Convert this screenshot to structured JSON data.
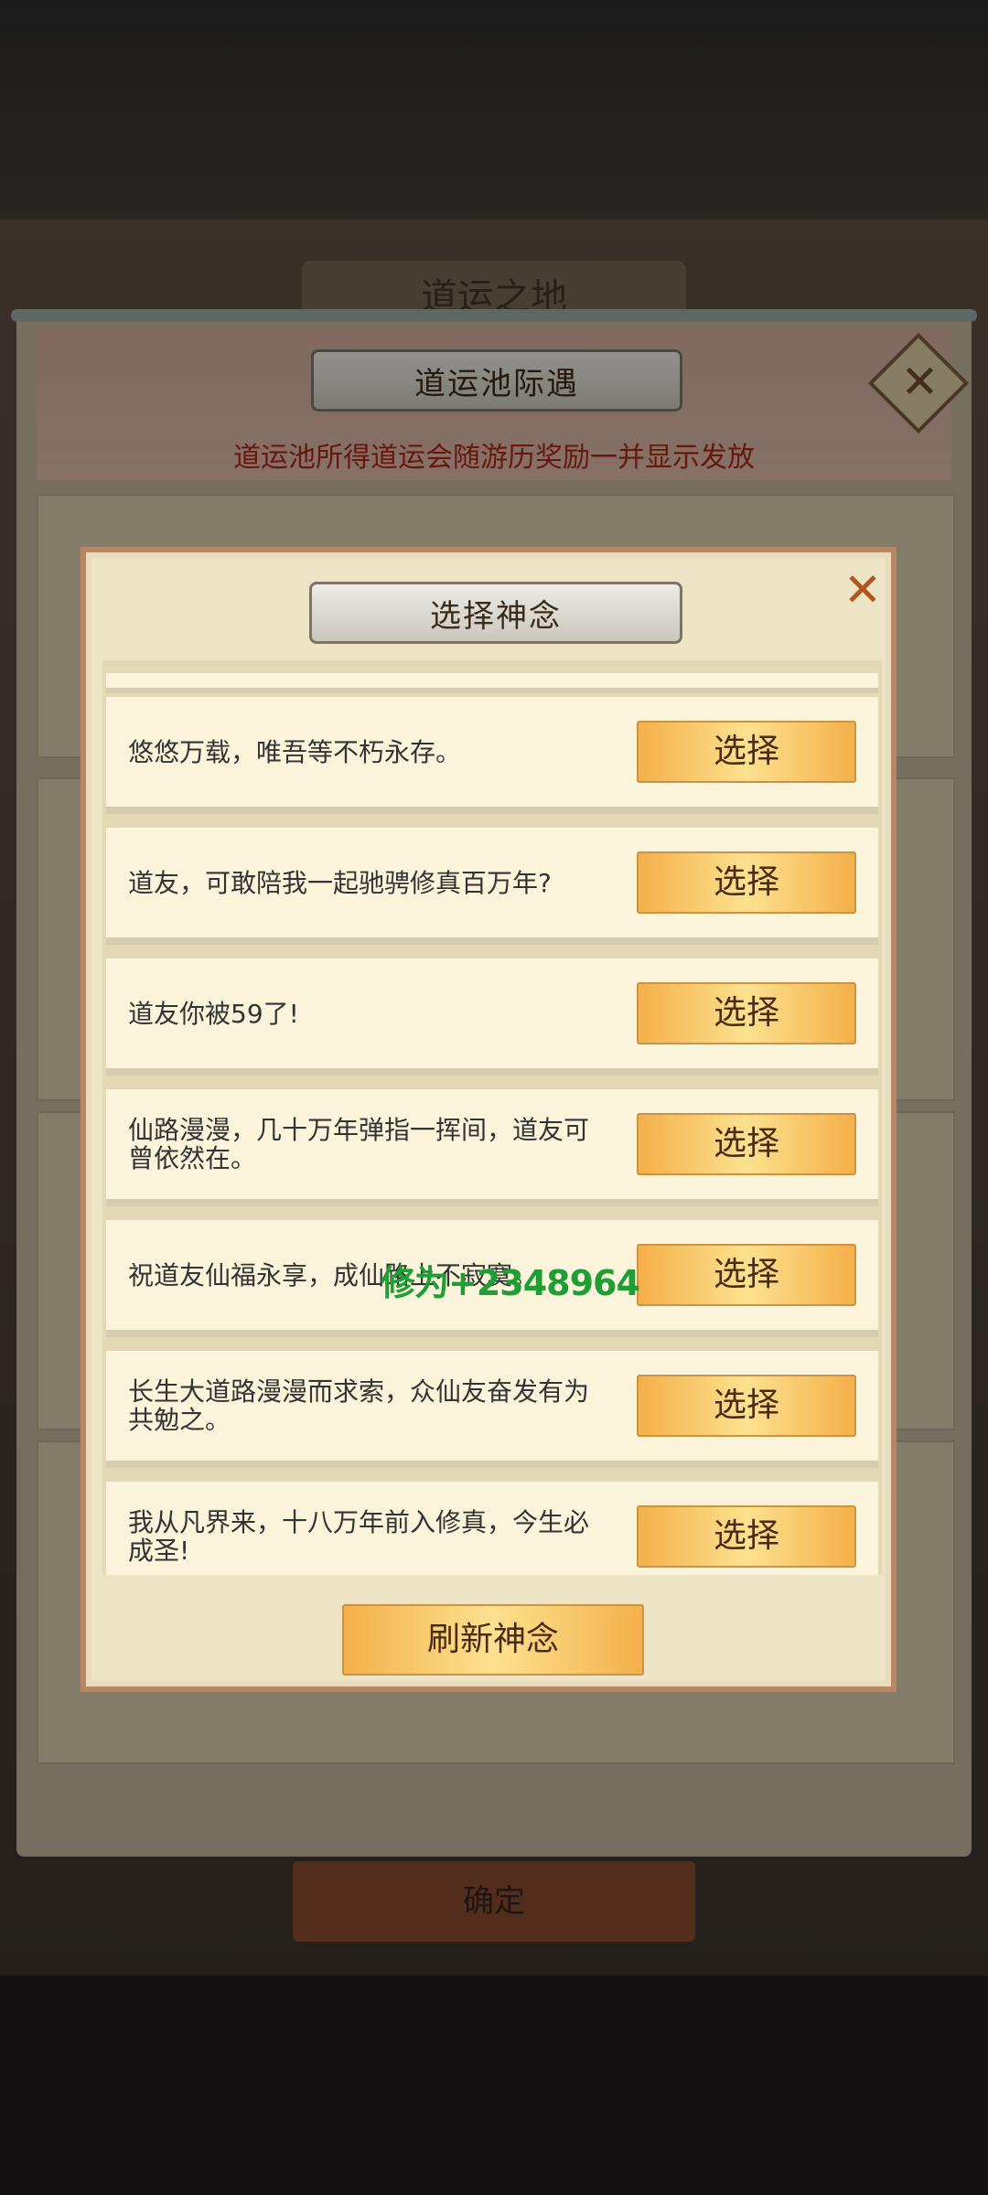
{
  "background": {
    "title": "道运之地",
    "confirm_label": "确定"
  },
  "back_panel": {
    "title": "道运池际遇",
    "subtitle": "道运池所得道运会随游历奖励一并显示发放",
    "close_icon": "close-icon"
  },
  "dialog": {
    "title": "选择神念",
    "close_icon": "close-icon",
    "refresh_label": "刷新神念",
    "select_label": "选择",
    "options": [
      {
        "text": "悠悠万载，唯吾等不朽永存。"
      },
      {
        "text": "道友，可敢陪我一起驰骋修真百万年?"
      },
      {
        "text": "道友你被59了!"
      },
      {
        "text": "仙路漫漫，几十万年弹指一挥间，道友可曾依然在。"
      },
      {
        "text": "祝道友仙福永享，成仙路上不寂寞。"
      },
      {
        "text": "长生大道路漫漫而求索，众仙友奋发有为共勉之。"
      },
      {
        "text": "我从凡界来，十八万年前入修真，今生必成圣!"
      }
    ]
  },
  "watermark": "修为+2348964",
  "colors": {
    "accent_red": "#a7261b",
    "button_gold": "#fde18f",
    "dialog_bg": "#ede4c5",
    "watermark_green": "#1f9e36"
  }
}
